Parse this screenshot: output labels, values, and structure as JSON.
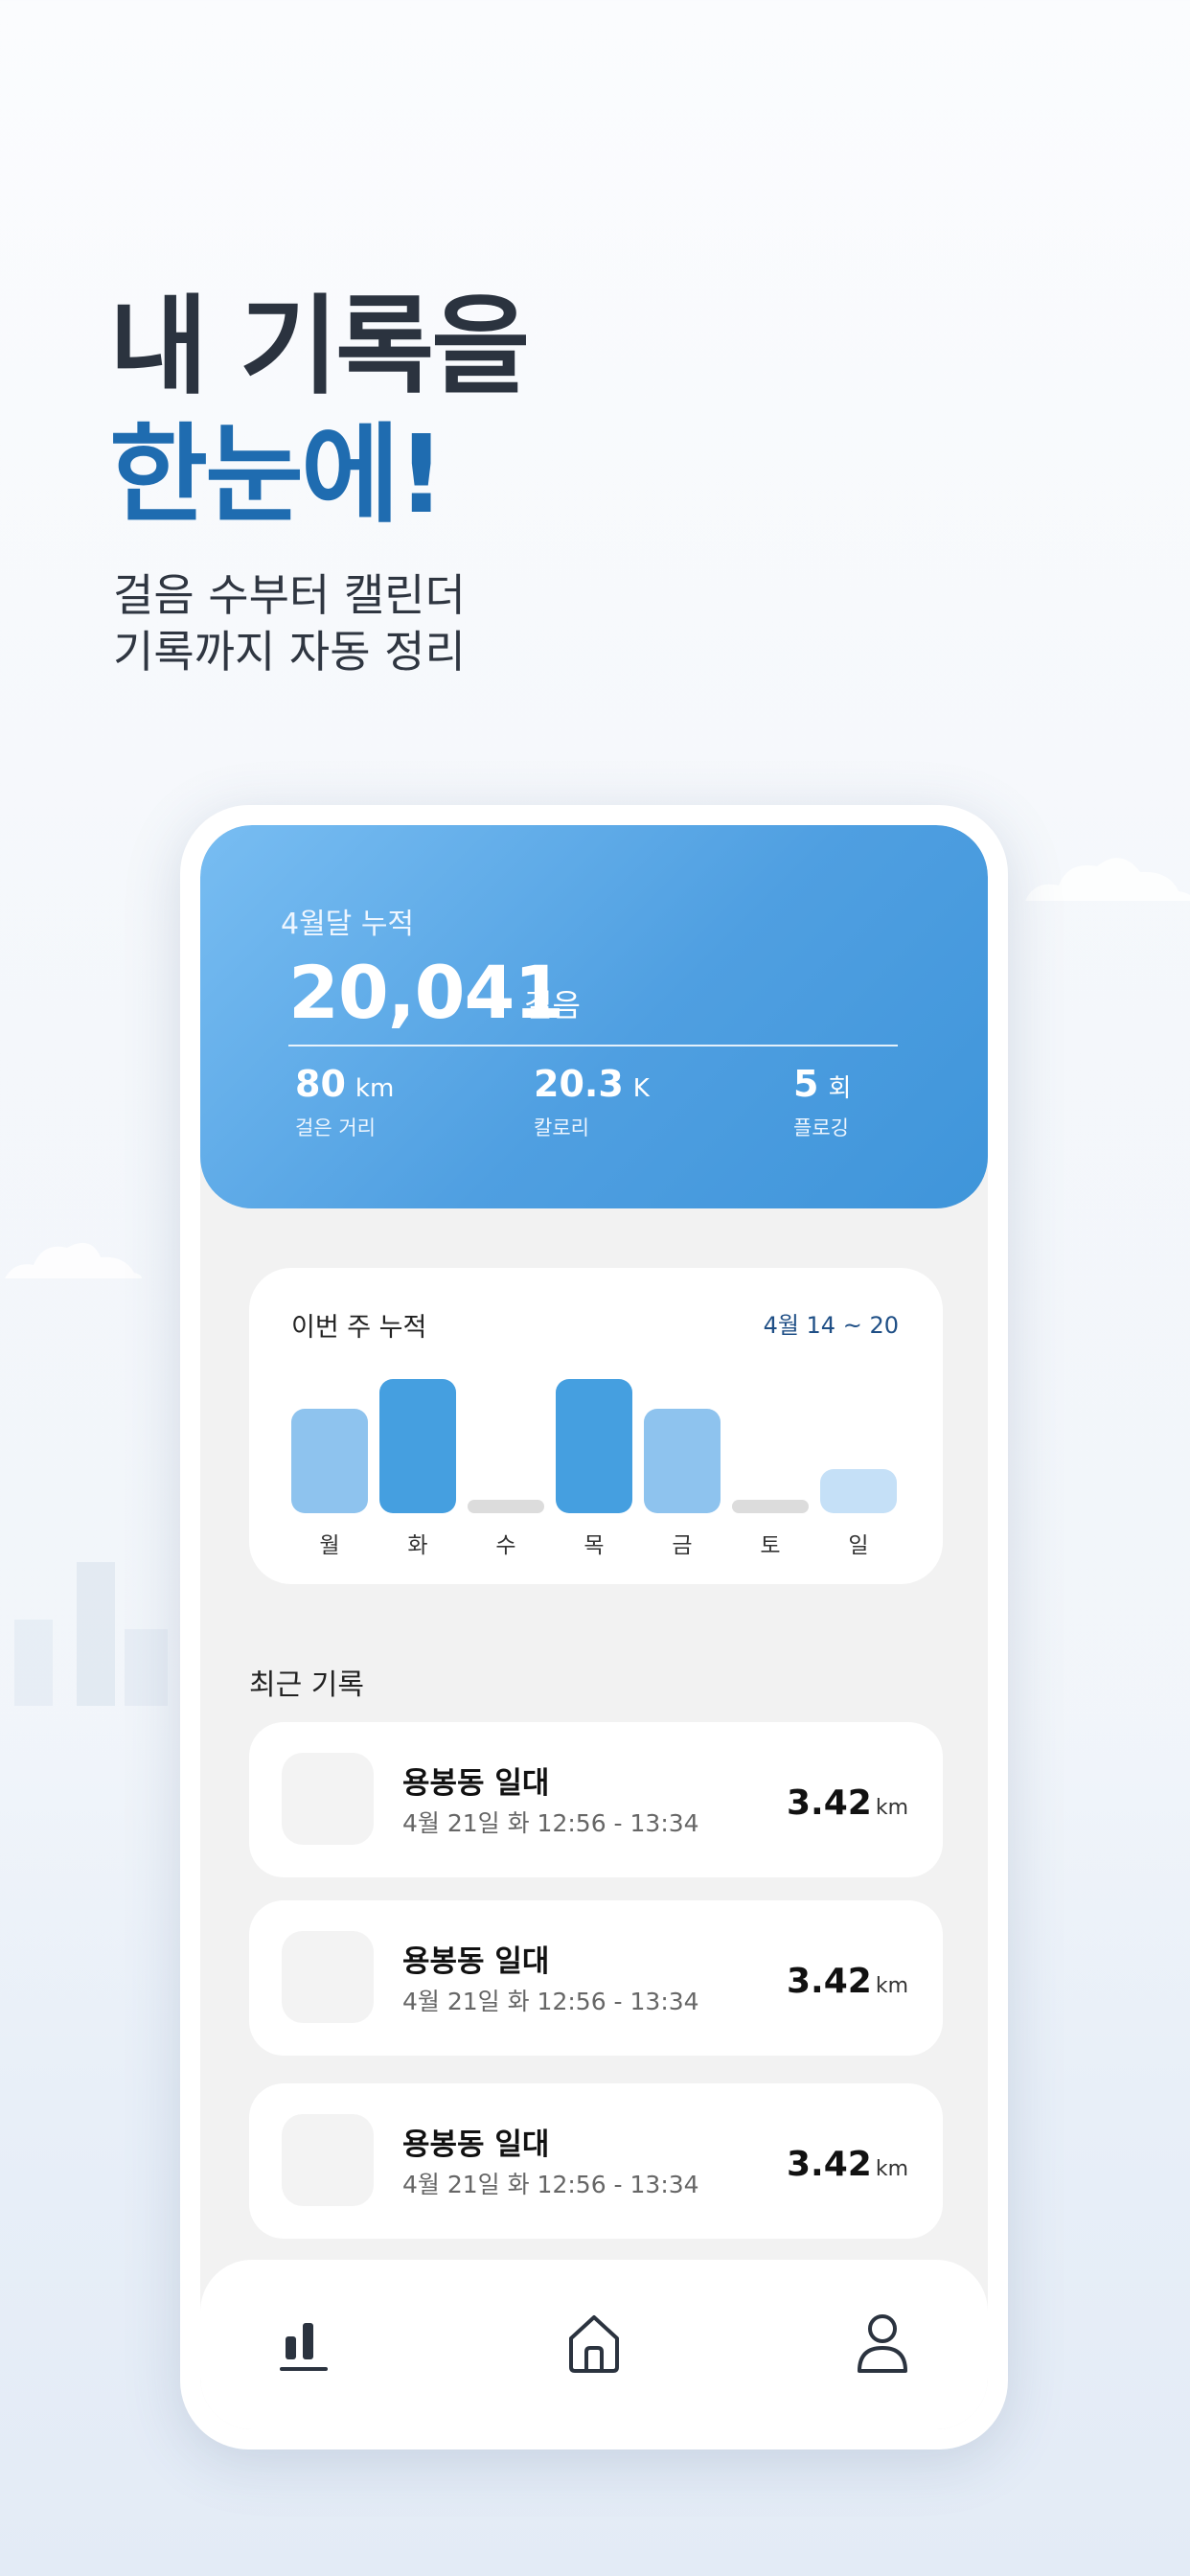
{
  "headline": {
    "line1": "내 기록을",
    "line2": "한눈에!"
  },
  "subline": {
    "line1": "걸음 수부터 캘린더",
    "line2": "기록까지 자동 정리"
  },
  "summary": {
    "label": "4월달 누적",
    "steps": "20,041",
    "steps_unit": "걸음",
    "stats": [
      {
        "value": "80",
        "unit": "km",
        "caption": "걸은 거리"
      },
      {
        "value": "20.3",
        "unit": "K",
        "caption": "칼로리"
      },
      {
        "value": "5",
        "unit": "회",
        "caption": "플로깅"
      }
    ]
  },
  "week": {
    "title": "이번 주 누적",
    "range": "4월 14 ~ 20",
    "days": [
      "월",
      "화",
      "수",
      "목",
      "금",
      "토",
      "일"
    ]
  },
  "chart_data": {
    "type": "bar",
    "categories": [
      "월",
      "화",
      "수",
      "목",
      "금",
      "토",
      "일"
    ],
    "values": [
      0.78,
      1.0,
      0.09,
      1.0,
      0.78,
      0.09,
      0.33
    ],
    "colors": [
      "#8ec3ee",
      "#459fe0",
      "#dcdcdc",
      "#459fe0",
      "#8ec3ee",
      "#dcdcdc",
      "#c5e0f7"
    ],
    "ylim": [
      0,
      1
    ]
  },
  "recent": {
    "title": "최근 기록",
    "items": [
      {
        "name": "용봉동 일대",
        "time": "4월 21일 화 12:56 - 13:34",
        "distance": "3.42",
        "unit": "km"
      },
      {
        "name": "용봉동 일대",
        "time": "4월 21일 화 12:56 - 13:34",
        "distance": "3.42",
        "unit": "km"
      },
      {
        "name": "용봉동 일대",
        "time": "4월 21일 화 12:56 - 13:34",
        "distance": "3.42",
        "unit": "km"
      }
    ]
  },
  "tabs": [
    {
      "icon": "bar-chart-icon"
    },
    {
      "icon": "home-icon"
    },
    {
      "icon": "user-icon"
    }
  ]
}
